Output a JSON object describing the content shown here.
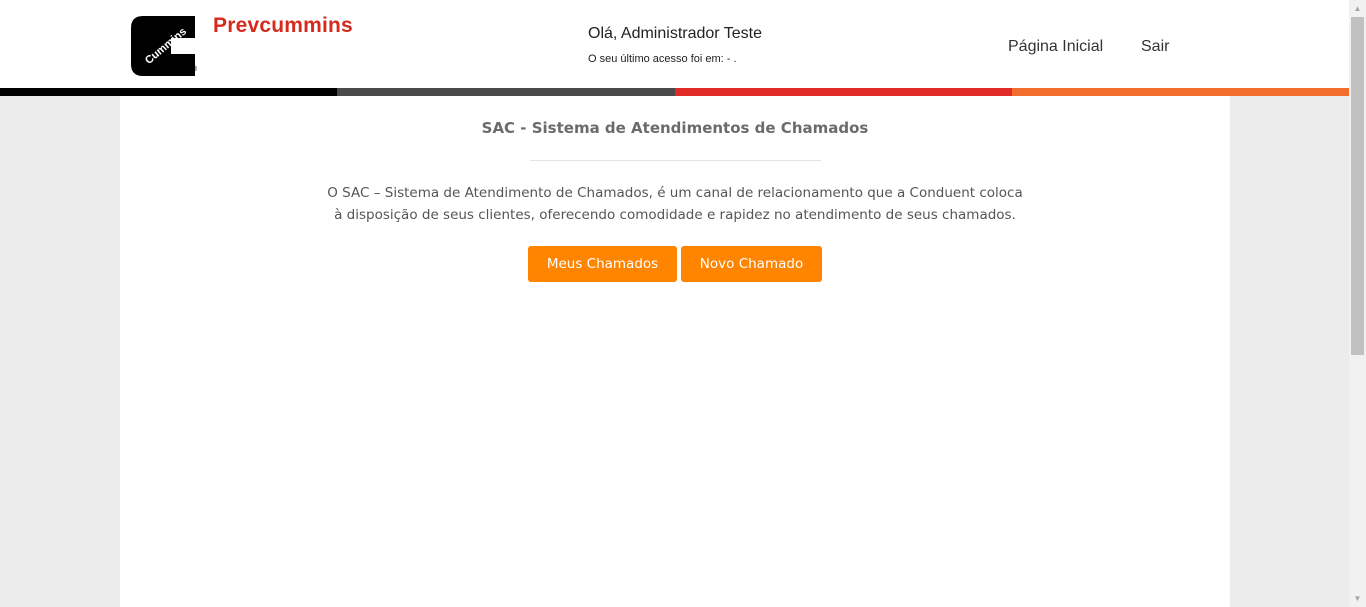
{
  "header": {
    "brand": "Prevcummins",
    "logo_text": "Cummins",
    "logo_registered": "®",
    "greeting": "Olá, Administrador Teste",
    "last_access": "O seu último acesso foi em: - .",
    "nav": {
      "home": "Página Inicial",
      "exit": "Sair"
    }
  },
  "stripe_colors": [
    "#000000",
    "#4a4a4a",
    "#e02a26",
    "#f26d2c"
  ],
  "main": {
    "title": "SAC - Sistema de Atendimentos de Chamados",
    "description": "O SAC – Sistema de Atendimento de Chamados, é um canal de relacionamento que a Conduent coloca à disposição de seus clientes, oferecendo comodidade e rapidez no atendimento de seus chamados.",
    "buttons": {
      "my_tickets": "Meus Chamados",
      "new_ticket": "Novo Chamado"
    }
  },
  "colors": {
    "brand_red": "#d52b1e",
    "button_orange": "#ff8400",
    "background": "#ececec"
  },
  "scrollbar": {
    "up_icon": "▲",
    "down_icon": "▼"
  }
}
